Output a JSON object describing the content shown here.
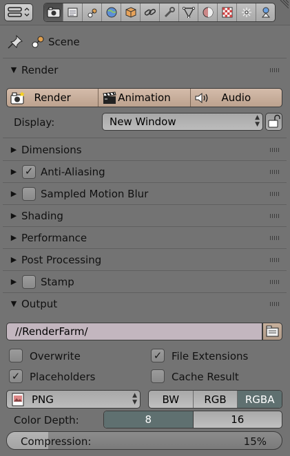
{
  "toolbar": {
    "menu_icon": "editor-menu-icon",
    "tabs": [
      {
        "icon": "render-camera-icon",
        "active": true
      },
      {
        "icon": "render-layers-icon"
      },
      {
        "icon": "scene-icon"
      },
      {
        "icon": "world-icon"
      },
      {
        "icon": "object-icon"
      },
      {
        "icon": "constraints-icon"
      },
      {
        "icon": "modifiers-icon"
      },
      {
        "icon": "object-data-icon"
      },
      {
        "icon": "material-icon"
      },
      {
        "icon": "texture-icon"
      },
      {
        "icon": "particles-icon"
      },
      {
        "icon": "physics-icon"
      }
    ]
  },
  "context": {
    "scene_label": "Scene"
  },
  "panels": {
    "render": {
      "title": "Render",
      "buttons": {
        "render": "Render",
        "animation": "Animation",
        "audio": "Audio"
      },
      "display_label": "Display:",
      "display_value": "New Window"
    },
    "dimensions": {
      "title": "Dimensions"
    },
    "anti_aliasing": {
      "title": "Anti-Aliasing",
      "checked": true
    },
    "motion_blur": {
      "title": "Sampled Motion Blur",
      "checked": false
    },
    "shading": {
      "title": "Shading"
    },
    "performance": {
      "title": "Performance"
    },
    "post_processing": {
      "title": "Post Processing"
    },
    "stamp": {
      "title": "Stamp",
      "checked": false
    },
    "output": {
      "title": "Output",
      "path": "//RenderFarm/",
      "overwrite": {
        "label": "Overwrite",
        "checked": false
      },
      "file_extensions": {
        "label": "File Extensions",
        "checked": true
      },
      "placeholders": {
        "label": "Placeholders",
        "checked": true
      },
      "cache_result": {
        "label": "Cache Result",
        "checked": false
      },
      "format": "PNG",
      "color_modes": [
        "BW",
        "RGB",
        "RGBA"
      ],
      "color_mode_selected": "RGBA",
      "color_depth_label": "Color Depth:",
      "color_depths": [
        "8",
        "16"
      ],
      "color_depth_selected": "8",
      "compression_label": "Compression:",
      "compression_value": "15%",
      "compression_fraction": 0.15
    }
  },
  "colors": {
    "accent": "#5f7070",
    "button": "#c8b09c",
    "panel_bg": "#737373"
  }
}
